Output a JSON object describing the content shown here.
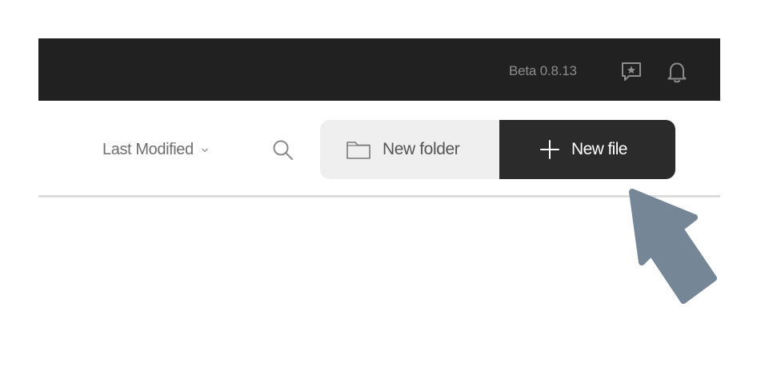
{
  "topbar": {
    "version_label": "Beta 0.8.13",
    "feedback_icon": "feedback-icon",
    "bell_icon": "bell-icon"
  },
  "toolbar": {
    "sort_label": "Last Modified",
    "sort_icon": "chevron-down-icon",
    "search_icon": "search-icon",
    "new_folder_label": "New folder",
    "new_folder_icon": "folder-icon",
    "new_file_label": "New file",
    "new_file_icon": "plus-icon"
  },
  "annotation": {
    "arrow_icon": "pointer-arrow-icon",
    "arrow_color": "#758797"
  },
  "colors": {
    "topbar_bg": "#212121",
    "new_folder_bg": "#efefef",
    "new_file_bg": "#2b2b2b"
  }
}
